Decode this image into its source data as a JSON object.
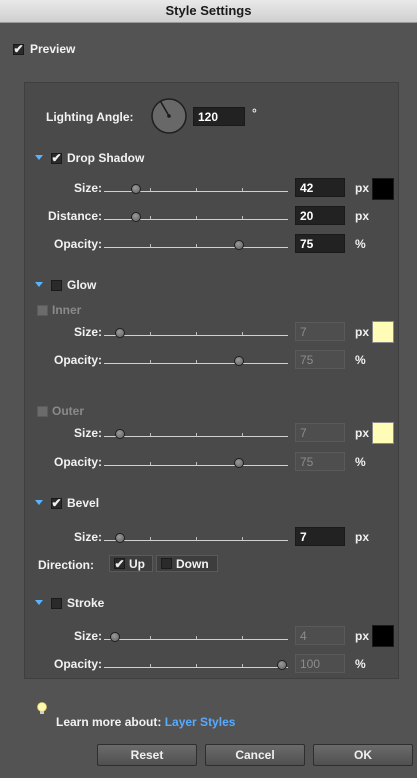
{
  "window": {
    "title": "Style Settings"
  },
  "preview": {
    "label": "Preview",
    "checked": true
  },
  "lighting": {
    "label": "Lighting Angle:",
    "value": "120",
    "unit": "°"
  },
  "drop_shadow": {
    "label": "Drop Shadow",
    "checked": true,
    "color": "#000000",
    "size": {
      "label": "Size:",
      "value": "42",
      "unit": "px",
      "fraction": 0.15
    },
    "distance": {
      "label": "Distance:",
      "value": "20",
      "unit": "px",
      "fraction": 0.15
    },
    "opacity": {
      "label": "Opacity:",
      "value": "75",
      "unit": "%",
      "fraction": 0.75
    }
  },
  "glow": {
    "label": "Glow",
    "checked": false,
    "inner": {
      "label": "Inner",
      "color": "#fffcb8",
      "size": {
        "label": "Size:",
        "value": "7",
        "unit": "px",
        "fraction": 0.06
      },
      "opacity": {
        "label": "Opacity:",
        "value": "75",
        "unit": "%",
        "fraction": 0.75
      }
    },
    "outer": {
      "label": "Outer",
      "color": "#fffcb8",
      "size": {
        "label": "Size:",
        "value": "7",
        "unit": "px",
        "fraction": 0.06
      },
      "opacity": {
        "label": "Opacity:",
        "value": "75",
        "unit": "%",
        "fraction": 0.75
      }
    }
  },
  "bevel": {
    "label": "Bevel",
    "checked": true,
    "size": {
      "label": "Size:",
      "value": "7",
      "unit": "px",
      "fraction": 0.06
    },
    "direction": {
      "label": "Direction:",
      "up": "Up",
      "down": "Down",
      "selected": "Up"
    }
  },
  "stroke": {
    "label": "Stroke",
    "checked": false,
    "color": "#000000",
    "size": {
      "label": "Size:",
      "value": "4",
      "unit": "px",
      "fraction": 0.03
    },
    "opacity": {
      "label": "Opacity:",
      "value": "100",
      "unit": "%",
      "fraction": 1.0
    }
  },
  "footer": {
    "learn_more": "Learn more about:",
    "link": "Layer Styles",
    "reset": "Reset",
    "cancel": "Cancel",
    "ok": "OK"
  }
}
